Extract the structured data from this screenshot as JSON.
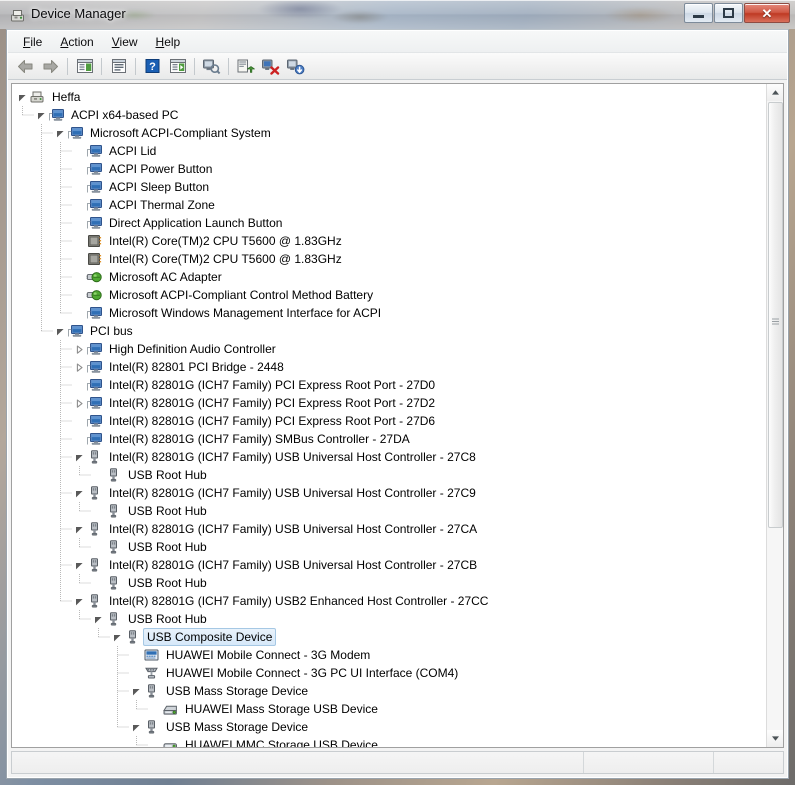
{
  "window": {
    "title": "Device Manager",
    "title_icon": "device-manager-icon",
    "buttons": {
      "minimize": "Minimize",
      "maximize": "Restore",
      "close": "Close"
    }
  },
  "menubar": {
    "items": [
      {
        "label": "File",
        "accel": "F"
      },
      {
        "label": "Action",
        "accel": "A"
      },
      {
        "label": "View",
        "accel": "V"
      },
      {
        "label": "Help",
        "accel": "H"
      }
    ]
  },
  "toolbar": {
    "buttons": [
      {
        "name": "back-arrow-icon",
        "title": "Back",
        "enabled": false
      },
      {
        "name": "forward-arrow-icon",
        "title": "Forward",
        "enabled": false
      },
      {
        "name": "show-hide-console-tree-icon",
        "title": "Show/Hide Console Tree"
      },
      {
        "name": "properties-icon",
        "title": "Properties"
      },
      {
        "name": "help-icon",
        "title": "Help"
      },
      {
        "name": "show-hide-action-pane-icon",
        "title": "Show/Hide Action Pane"
      },
      {
        "name": "scan-for-hardware-changes-icon",
        "title": "Scan for hardware changes"
      },
      {
        "name": "update-driver-icon",
        "title": "Update Driver Software"
      },
      {
        "name": "uninstall-device-icon",
        "title": "Uninstall"
      },
      {
        "name": "disable-device-icon",
        "title": "Disable"
      }
    ]
  },
  "statusbar": {
    "message": "",
    "pane2": "",
    "pane3": ""
  },
  "scrollbar": {
    "up_arrow": "scroll-up-icon",
    "down_arrow": "scroll-down-icon",
    "thumb": "scrollbar-thumb"
  },
  "tree": {
    "rows": [
      {
        "depth": 0,
        "twisty": "expanded",
        "icon": "computer-icon",
        "label": "Heffa",
        "selected": false
      },
      {
        "depth": 1,
        "twisty": "expanded",
        "icon": "system-device-icon",
        "label": "ACPI x64-based PC",
        "selected": false
      },
      {
        "depth": 2,
        "twisty": "expanded",
        "icon": "system-device-icon",
        "label": "Microsoft ACPI-Compliant System",
        "selected": false
      },
      {
        "depth": 3,
        "twisty": "leaf",
        "icon": "system-device-icon",
        "label": "ACPI Lid",
        "selected": false
      },
      {
        "depth": 3,
        "twisty": "leaf",
        "icon": "system-device-icon",
        "label": "ACPI Power Button",
        "selected": false
      },
      {
        "depth": 3,
        "twisty": "leaf",
        "icon": "system-device-icon",
        "label": "ACPI Sleep Button",
        "selected": false
      },
      {
        "depth": 3,
        "twisty": "leaf",
        "icon": "system-device-icon",
        "label": "ACPI Thermal Zone",
        "selected": false
      },
      {
        "depth": 3,
        "twisty": "leaf",
        "icon": "system-device-icon",
        "label": "Direct Application Launch Button",
        "selected": false
      },
      {
        "depth": 3,
        "twisty": "leaf",
        "icon": "processor-icon",
        "label": "Intel(R) Core(TM)2 CPU        T5600  @ 1.83GHz",
        "selected": false
      },
      {
        "depth": 3,
        "twisty": "leaf",
        "icon": "processor-icon",
        "label": "Intel(R) Core(TM)2 CPU        T5600  @ 1.83GHz",
        "selected": false
      },
      {
        "depth": 3,
        "twisty": "leaf",
        "icon": "battery-icon",
        "label": "Microsoft AC Adapter",
        "selected": false
      },
      {
        "depth": 3,
        "twisty": "leaf",
        "icon": "battery-icon",
        "label": "Microsoft ACPI-Compliant Control Method Battery",
        "selected": false
      },
      {
        "depth": 3,
        "twisty": "leaf",
        "icon": "system-device-icon",
        "label": "Microsoft Windows Management Interface for ACPI",
        "selected": false
      },
      {
        "depth": 2,
        "twisty": "expanded",
        "icon": "system-device-icon",
        "label": "PCI bus",
        "selected": false
      },
      {
        "depth": 3,
        "twisty": "collapsed",
        "icon": "system-device-icon",
        "label": "High Definition Audio Controller",
        "selected": false
      },
      {
        "depth": 3,
        "twisty": "collapsed",
        "icon": "system-device-icon",
        "label": "Intel(R) 82801 PCI Bridge - 2448",
        "selected": false
      },
      {
        "depth": 3,
        "twisty": "leaf",
        "icon": "system-device-icon",
        "label": "Intel(R) 82801G (ICH7 Family) PCI Express Root Port - 27D0",
        "selected": false
      },
      {
        "depth": 3,
        "twisty": "collapsed",
        "icon": "system-device-icon",
        "label": "Intel(R) 82801G (ICH7 Family) PCI Express Root Port - 27D2",
        "selected": false
      },
      {
        "depth": 3,
        "twisty": "leaf",
        "icon": "system-device-icon",
        "label": "Intel(R) 82801G (ICH7 Family) PCI Express Root Port - 27D6",
        "selected": false
      },
      {
        "depth": 3,
        "twisty": "leaf",
        "icon": "system-device-icon",
        "label": "Intel(R) 82801G (ICH7 Family) SMBus Controller - 27DA",
        "selected": false
      },
      {
        "depth": 3,
        "twisty": "expanded",
        "icon": "usb-icon",
        "label": "Intel(R) 82801G (ICH7 Family) USB Universal Host Controller - 27C8",
        "selected": false
      },
      {
        "depth": 4,
        "twisty": "leaf",
        "icon": "usb-icon",
        "label": "USB Root Hub",
        "selected": false
      },
      {
        "depth": 3,
        "twisty": "expanded",
        "icon": "usb-icon",
        "label": "Intel(R) 82801G (ICH7 Family) USB Universal Host Controller - 27C9",
        "selected": false
      },
      {
        "depth": 4,
        "twisty": "leaf",
        "icon": "usb-icon",
        "label": "USB Root Hub",
        "selected": false
      },
      {
        "depth": 3,
        "twisty": "expanded",
        "icon": "usb-icon",
        "label": "Intel(R) 82801G (ICH7 Family) USB Universal Host Controller - 27CA",
        "selected": false
      },
      {
        "depth": 4,
        "twisty": "leaf",
        "icon": "usb-icon",
        "label": "USB Root Hub",
        "selected": false
      },
      {
        "depth": 3,
        "twisty": "expanded",
        "icon": "usb-icon",
        "label": "Intel(R) 82801G (ICH7 Family) USB Universal Host Controller - 27CB",
        "selected": false
      },
      {
        "depth": 4,
        "twisty": "leaf",
        "icon": "usb-icon",
        "label": "USB Root Hub",
        "selected": false
      },
      {
        "depth": 3,
        "twisty": "expanded",
        "icon": "usb-icon",
        "label": "Intel(R) 82801G (ICH7 Family) USB2 Enhanced Host Controller - 27CC",
        "selected": false
      },
      {
        "depth": 4,
        "twisty": "expanded",
        "icon": "usb-icon",
        "label": "USB Root Hub",
        "selected": false
      },
      {
        "depth": 5,
        "twisty": "expanded",
        "icon": "usb-icon",
        "label": "USB Composite Device",
        "selected": true
      },
      {
        "depth": 6,
        "twisty": "leaf",
        "icon": "modem-icon",
        "label": "HUAWEI Mobile Connect - 3G Modem",
        "selected": false
      },
      {
        "depth": 6,
        "twisty": "leaf",
        "icon": "port-icon",
        "label": "HUAWEI Mobile Connect - 3G PC UI Interface (COM4)",
        "selected": false
      },
      {
        "depth": 6,
        "twisty": "expanded",
        "icon": "usb-icon",
        "label": "USB Mass Storage Device",
        "selected": false
      },
      {
        "depth": 7,
        "twisty": "leaf",
        "icon": "disk-drive-icon",
        "label": "HUAWEI Mass Storage USB Device",
        "selected": false
      },
      {
        "depth": 6,
        "twisty": "expanded",
        "icon": "usb-icon",
        "label": "USB Mass Storage Device",
        "selected": false
      },
      {
        "depth": 7,
        "twisty": "leaf",
        "icon": "mmc-storage-icon",
        "label": "HUAWEI MMC Storage USB Device",
        "selected": false
      }
    ]
  },
  "colors": {
    "selection_fill": "#d6e8f9",
    "selection_border": "#a6c8e4",
    "tree_background": "#ffffff",
    "close_button": "#bf3a24",
    "device_icon_blue": "#2f6fb5",
    "battery_icon_green": "#4a9b2f"
  }
}
